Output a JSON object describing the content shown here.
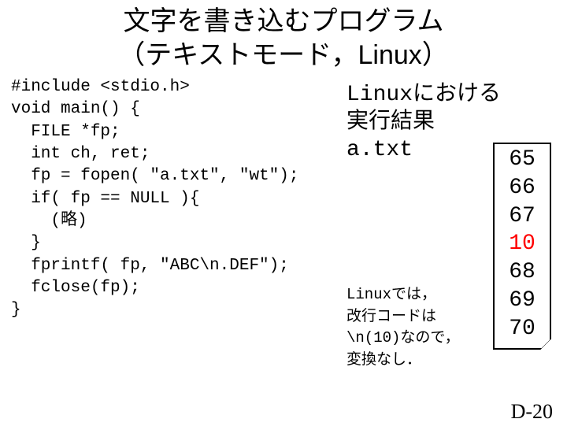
{
  "title_line1": "文字を書き込むプログラム",
  "title_line2": "（テキストモード，Linux）",
  "code": "#include <stdio.h>\nvoid main() {\n  FILE *fp;\n  int ch, ret;\n  fp = fopen( \"a.txt\", \"wt\");\n  if( fp == NULL ){\n    (略)\n  }\n  fprintf( fp, \"ABC\\n.DEF\");\n  fclose(fp);\n}",
  "result_label": "Linuxにおける\n実行結果\na.txt",
  "file_values": [
    "65",
    "66",
    "67",
    "10",
    "68",
    "69",
    "70"
  ],
  "highlight_index": 3,
  "note": "Linuxでは，\n改行コードは\n\\n(10)なので，\n変換なし．",
  "page_number": "D-20"
}
